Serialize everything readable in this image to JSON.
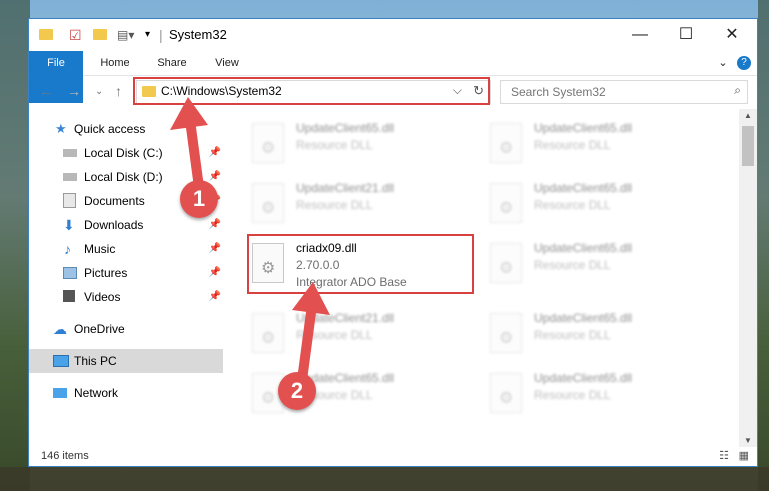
{
  "window": {
    "title": "System32",
    "controls": {
      "minimize": "—",
      "maximize": "☐",
      "close": "✕"
    }
  },
  "ribbon": {
    "tabs": [
      "File",
      "Home",
      "Share",
      "View"
    ],
    "help": "?"
  },
  "address": {
    "path": "C:\\Windows\\System32",
    "dropdown_glyph": "⌵",
    "refresh_glyph": "↻"
  },
  "search": {
    "placeholder": "Search System32",
    "icon": "search-icon"
  },
  "sidebar": {
    "items": [
      {
        "label": "Quick access",
        "icon": "star-icon",
        "pinned": false
      },
      {
        "label": "Local Disk (C:)",
        "icon": "drive-icon",
        "pinned": true
      },
      {
        "label": "Local Disk (D:)",
        "icon": "drive-icon",
        "pinned": true
      },
      {
        "label": "Documents",
        "icon": "documents-icon",
        "pinned": true
      },
      {
        "label": "Downloads",
        "icon": "downloads-icon",
        "pinned": true
      },
      {
        "label": "Music",
        "icon": "music-icon",
        "pinned": true
      },
      {
        "label": "Pictures",
        "icon": "pictures-icon",
        "pinned": true
      },
      {
        "label": "Videos",
        "icon": "videos-icon",
        "pinned": true
      },
      {
        "label": "OneDrive",
        "icon": "onedrive-icon",
        "pinned": false
      },
      {
        "label": "This PC",
        "icon": "pc-icon",
        "pinned": false,
        "selected": true
      },
      {
        "label": "Network",
        "icon": "network-icon",
        "pinned": false
      }
    ]
  },
  "files": {
    "left": [
      {
        "name": "UpdateClient65.dll",
        "type": "Resource DLL"
      },
      {
        "name": "UpdateClient21.dll",
        "type": "Resource DLL"
      },
      {
        "name": "criadx09.dll",
        "version": "2.70.0.0",
        "desc": "Integrator ADO Base",
        "highlight": true
      },
      {
        "name": "UpdateClient21.dll",
        "type": "Resource DLL"
      },
      {
        "name": "UpdateClient65.dll",
        "type": "Resource DLL"
      }
    ],
    "right": [
      {
        "name": "UpdateClient65.dll",
        "type": "Resource DLL"
      },
      {
        "name": "UpdateClient65.dll",
        "type": "Resource DLL"
      },
      {
        "name": "UpdateClient65.dll",
        "type": "Resource DLL"
      },
      {
        "name": "UpdateClient65.dll",
        "type": "Resource DLL"
      },
      {
        "name": "UpdateClient65.dll",
        "type": "Resource DLL"
      }
    ]
  },
  "status": {
    "items": "146 items"
  },
  "annotations": {
    "step1": "1",
    "step2": "2",
    "color": "#d94040"
  }
}
